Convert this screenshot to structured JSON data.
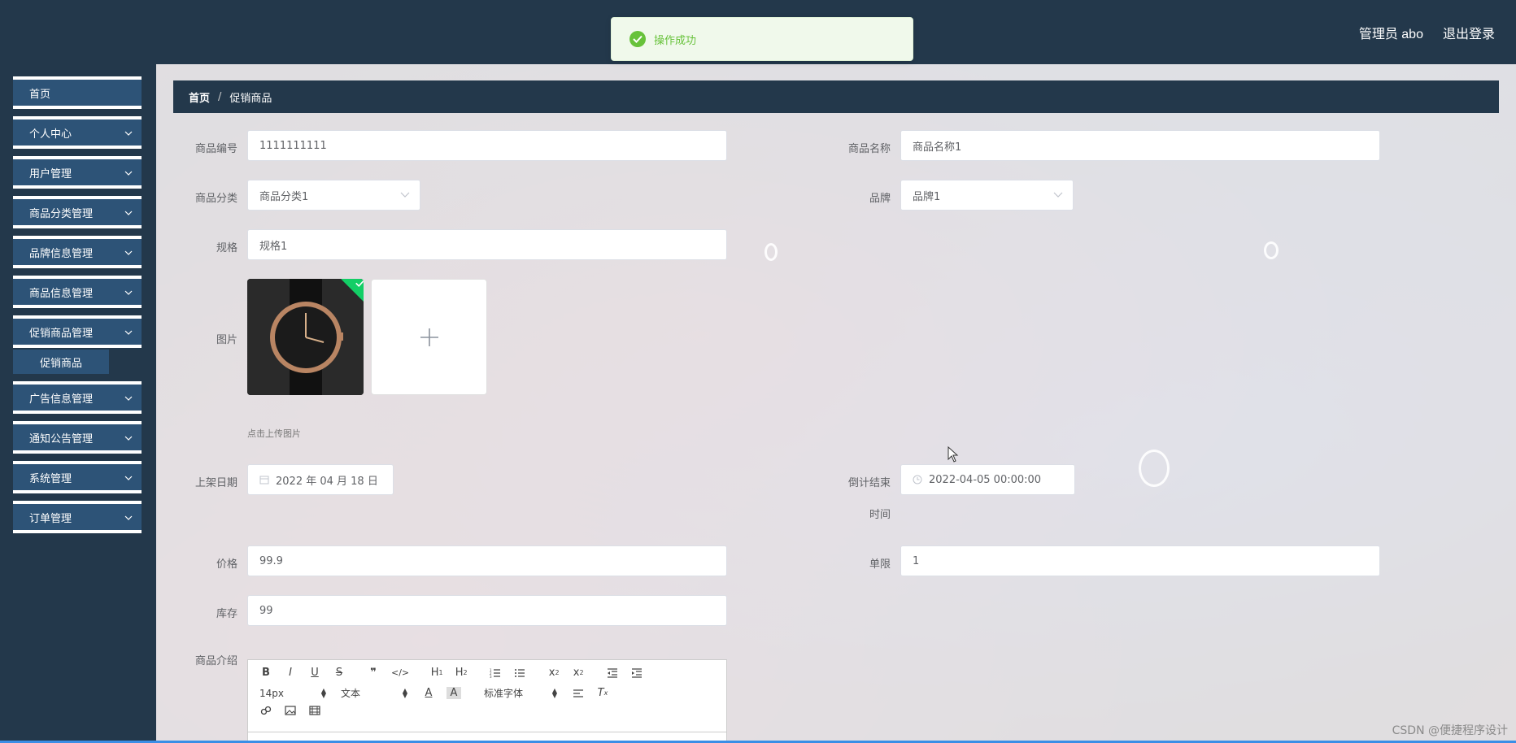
{
  "header": {
    "user_label": "管理员 abo",
    "logout_label": "退出登录"
  },
  "toast": {
    "message": "操作成功",
    "color": "#67c23a"
  },
  "sidebar": {
    "items": [
      {
        "label": "首页",
        "has_chevron": false
      },
      {
        "label": "个人中心",
        "has_chevron": true
      },
      {
        "label": "用户管理",
        "has_chevron": true
      },
      {
        "label": "商品分类管理",
        "has_chevron": true
      },
      {
        "label": "品牌信息管理",
        "has_chevron": true
      },
      {
        "label": "商品信息管理",
        "has_chevron": true
      },
      {
        "label": "促销商品管理",
        "has_chevron": true
      },
      {
        "label": "广告信息管理",
        "has_chevron": true
      },
      {
        "label": "通知公告管理",
        "has_chevron": true
      },
      {
        "label": "系统管理",
        "has_chevron": true
      },
      {
        "label": "订单管理",
        "has_chevron": true
      }
    ],
    "active_sub_item": "促销商品"
  },
  "breadcrumb": {
    "home": "首页",
    "separator": "/",
    "current": "促销商品"
  },
  "form": {
    "product_code": {
      "label": "商品编号",
      "value": "1111111111"
    },
    "product_name": {
      "label": "商品名称",
      "value": "商品名称1"
    },
    "category": {
      "label": "商品分类",
      "value": "商品分类1"
    },
    "brand": {
      "label": "品牌",
      "value": "品牌1"
    },
    "spec": {
      "label": "规格",
      "value": "规格1"
    },
    "image": {
      "label": "图片",
      "hint": "点击上传图片"
    },
    "listing_date": {
      "label": "上架日期",
      "value": "2022 年 04 月 18 日"
    },
    "countdown_end": {
      "label_line1": "倒计结束",
      "label_line2": "时间",
      "value": "2022-04-05 00:00:00"
    },
    "price": {
      "label": "价格",
      "value": "99.9"
    },
    "limit": {
      "label": "单限",
      "value": "1"
    },
    "stock": {
      "label": "库存",
      "value": "99"
    },
    "description": {
      "label": "商品介绍"
    }
  },
  "editor": {
    "font_size": "14px",
    "text_style": "文本",
    "font_family": "标准字体",
    "icons_row1": [
      "bold-icon",
      "italic-icon",
      "underline-icon",
      "strike-icon",
      "blockquote-icon",
      "code-icon",
      "h1-icon",
      "h2-icon",
      "ordered-list-icon",
      "bullet-list-icon",
      "subscript-icon",
      "superscript-icon",
      "outdent-icon",
      "indent-icon"
    ],
    "icons_row2": [
      "font-color-icon",
      "background-color-icon",
      "align-icon",
      "clear-format-icon"
    ],
    "icons_row3": [
      "link-icon",
      "image-icon",
      "video-icon"
    ]
  },
  "watermark": "CSDN @便捷程序设计"
}
